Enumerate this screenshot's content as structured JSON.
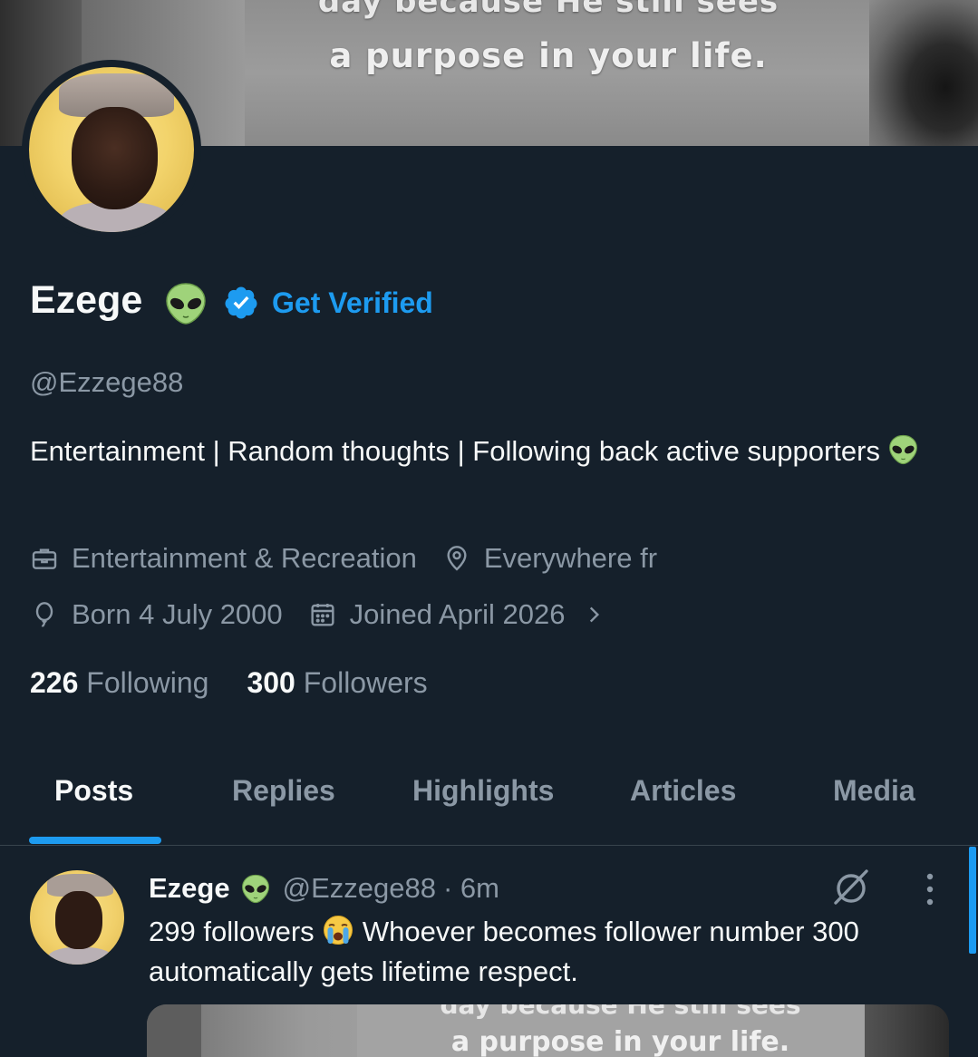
{
  "banner": {
    "line1": "day because He still sees",
    "line2": "a purpose in your life."
  },
  "profile": {
    "name": "Ezege",
    "get_verified": "Get Verified",
    "handle": "@Ezzege88",
    "bio": "Entertainment | Random thoughts | Following back active supporters",
    "category": "Entertainment & Recreation",
    "location": "Everywhere fr",
    "born": "Born 4 July 2000",
    "joined": "Joined April 2026",
    "following_count": "226",
    "following_label": "Following",
    "followers_count": "300",
    "followers_label": "Followers"
  },
  "tabs": [
    {
      "label": "Posts",
      "active": true
    },
    {
      "label": "Replies"
    },
    {
      "label": "Highlights"
    },
    {
      "label": "Articles"
    },
    {
      "label": "Media"
    }
  ],
  "post": {
    "author": "Ezege",
    "handle": "@Ezzege88",
    "time": "· 6m",
    "text_part1": "299 followers",
    "text_part2": "Whoever becomes follower number 300 automatically gets lifetime respect.",
    "media_line1": "day because He still sees",
    "media_line2": "a purpose in your life."
  },
  "colors": {
    "background": "#15202b",
    "accent": "#1d9bf0",
    "secondary_text": "#8b98a5",
    "primary_text": "#f7f9f9"
  },
  "icons": {
    "category": "briefcase-icon",
    "location": "location-pin-icon",
    "born": "balloon-icon",
    "joined": "calendar-icon",
    "badge": "verified-badge-icon",
    "grok": "grok-icon",
    "more": "more-vertical-icon"
  }
}
